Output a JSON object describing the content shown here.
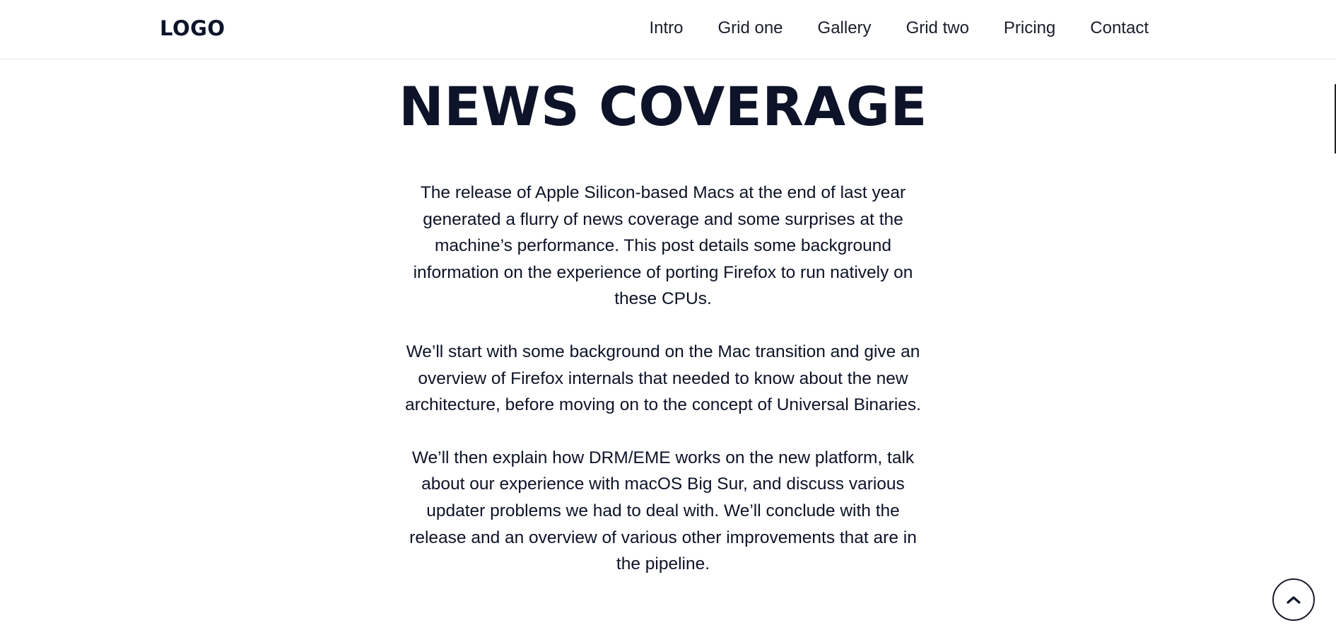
{
  "header": {
    "logo": "LOGO",
    "nav": [
      "Intro",
      "Grid one",
      "Gallery",
      "Grid two",
      "Pricing",
      "Contact"
    ]
  },
  "main": {
    "title": "NEWS COVERAGE",
    "paragraphs": [
      "The release of Apple Silicon-based Macs at the end of last year generated a flurry of news coverage and some surprises at the machine’s performance. This post details some background information on the experience of porting Firefox to run natively on these CPUs.",
      "We’ll start with some background on the Mac transition and give an overview of Firefox internals that needed to know about the new architecture, before moving on to the concept of Universal Binaries.",
      "We’ll then explain how DRM/EME works on the new platform, talk about our experience with macOS Big Sur, and discuss various updater problems we had to deal with. We’ll conclude with the release and an overview of various other improvements that are in the pipeline."
    ]
  },
  "back_to_top": {
    "icon": "chevron-up-icon"
  },
  "colors": {
    "text": "#0d1328",
    "border": "#e9e9ee",
    "background": "#ffffff"
  }
}
